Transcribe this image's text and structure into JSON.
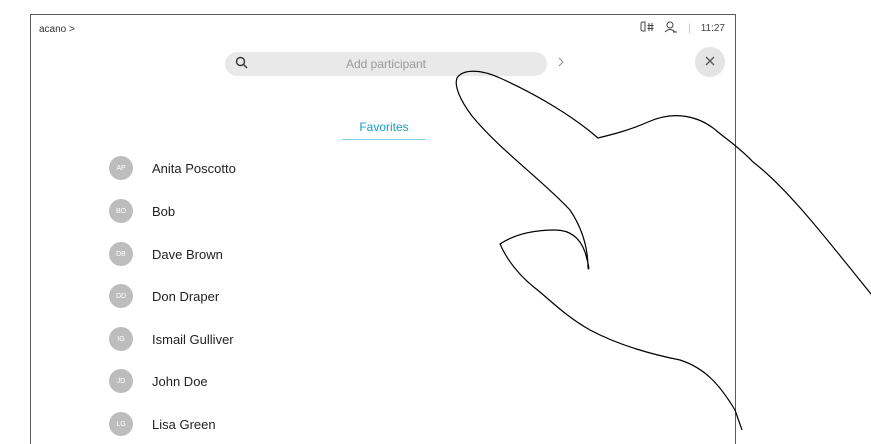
{
  "header": {
    "breadcrumb": "acano >",
    "time": "11:27",
    "separator": "|"
  },
  "search": {
    "placeholder": "Add participant"
  },
  "tabs": [
    {
      "label": "Favorites",
      "active": true
    }
  ],
  "contacts": [
    {
      "initials": "AP",
      "name": "Anita Poscotto"
    },
    {
      "initials": "BO",
      "name": "Bob"
    },
    {
      "initials": "DB",
      "name": "Dave Brown"
    },
    {
      "initials": "DD",
      "name": "Don Draper"
    },
    {
      "initials": "IG",
      "name": "Ismail Gulliver"
    },
    {
      "initials": "JD",
      "name": "John Doe"
    },
    {
      "initials": "LG",
      "name": "Lisa Green"
    }
  ],
  "icons": {
    "search": "search-icon",
    "chevron": "chevron-right-icon",
    "close": "close-icon",
    "phone": "phone-hash-icon",
    "contacts": "contacts-icon",
    "hand": "pointing-hand-icon"
  },
  "colors": {
    "accent": "#15a0c4",
    "avatar": "#bdbdbd",
    "searchBg": "#e9e9e9"
  }
}
